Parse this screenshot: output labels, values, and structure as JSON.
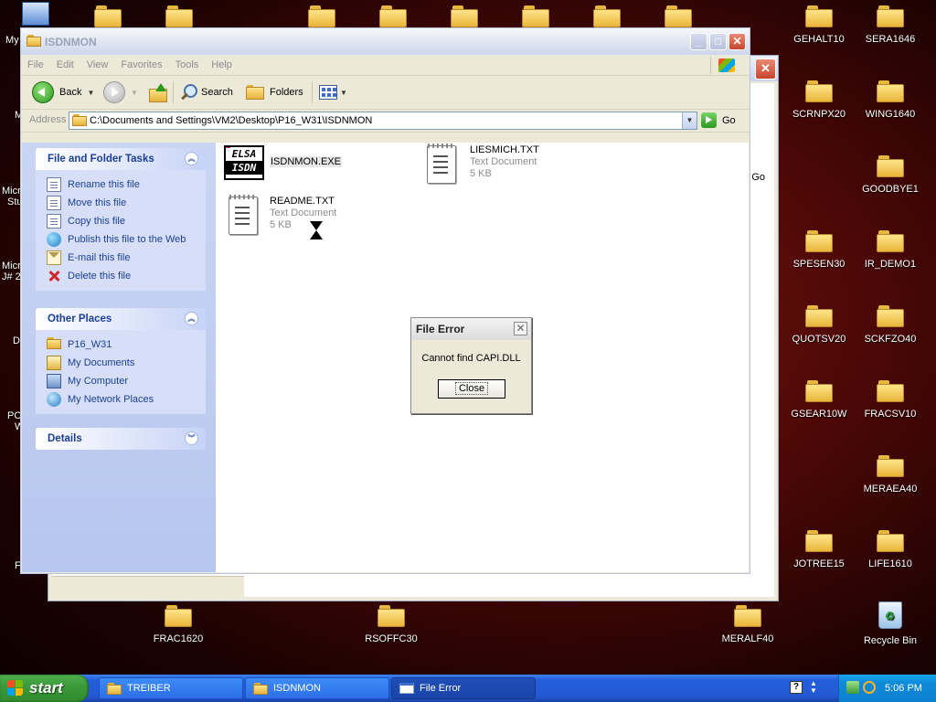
{
  "desktop": {
    "icons_right": [
      {
        "label": "GEHALT10"
      },
      {
        "label": "SERA1646"
      },
      {
        "label": "SCRNPX20"
      },
      {
        "label": "WING1640"
      },
      {
        "label": "GOODBYE1"
      },
      {
        "label": "SPESEN30"
      },
      {
        "label": "IR_DEMO1"
      },
      {
        "label": "QUOTSV20"
      },
      {
        "label": "SCKFZO40"
      },
      {
        "label": "GSEAR10W"
      },
      {
        "label": "FRACSV10"
      },
      {
        "label": "MERAEA40"
      },
      {
        "label": "JOTREE15"
      },
      {
        "label": "LIFE1610"
      },
      {
        "label": "Recycle Bin"
      }
    ],
    "icons_bottom": [
      {
        "label": "FRAC1620"
      },
      {
        "label": "RSOFFC30"
      },
      {
        "label": "MERALF40"
      }
    ],
    "peek_labels": [
      "My",
      "M",
      "Micr",
      "Stu",
      "Micr",
      "J# 2",
      "D",
      "PO",
      "W",
      "F"
    ]
  },
  "window": {
    "title": "ISDNMON",
    "menu": [
      "File",
      "Edit",
      "View",
      "Favorites",
      "Tools",
      "Help"
    ],
    "toolbar": {
      "back": "Back",
      "search": "Search",
      "folders": "Folders"
    },
    "address_label": "Address",
    "address_path": "C:\\Documents and Settings\\VM2\\Desktop\\P16_W31\\ISDNMON",
    "go_label": "Go",
    "back_window_peek": "Go"
  },
  "left_pane": {
    "file_tasks": {
      "title": "File and Folder Tasks",
      "items": [
        {
          "label": "Rename this file",
          "icon": "rename-icon"
        },
        {
          "label": "Move this file",
          "icon": "move-icon"
        },
        {
          "label": "Copy this file",
          "icon": "copy-icon"
        },
        {
          "label": "Publish this file to the Web",
          "icon": "globe-icon"
        },
        {
          "label": "E-mail this file",
          "icon": "email-icon"
        },
        {
          "label": "Delete this file",
          "icon": "delete-icon"
        }
      ]
    },
    "other_places": {
      "title": "Other Places",
      "items": [
        {
          "label": "P16_W31",
          "icon": "folder-icon"
        },
        {
          "label": "My Documents",
          "icon": "my-documents-icon"
        },
        {
          "label": "My Computer",
          "icon": "my-computer-icon"
        },
        {
          "label": "My Network Places",
          "icon": "network-places-icon"
        }
      ]
    },
    "details": {
      "title": "Details"
    }
  },
  "files": [
    {
      "name": "ISDNMON.EXE",
      "icon": "elsa-isdn-icon",
      "icon_text": [
        "ELSA",
        "ISDN"
      ]
    },
    {
      "name": "LIESMICH.TXT",
      "type": "Text Document",
      "size": "5 KB",
      "icon": "text-document-icon"
    },
    {
      "name": "README.TXT",
      "type": "Text Document",
      "size": "5 KB",
      "icon": "text-document-icon"
    }
  ],
  "dialog": {
    "title": "File Error",
    "message": "Cannot find CAPI.DLL",
    "button": "Close"
  },
  "taskbar": {
    "start": "start",
    "buttons": [
      {
        "label": "TREIBER",
        "icon": "folder-icon",
        "active": false
      },
      {
        "label": "ISDNMON",
        "icon": "folder-icon",
        "active": false
      },
      {
        "label": "File Error",
        "icon": "window-icon",
        "active": true
      }
    ],
    "clock": "5:06 PM"
  },
  "colors": {
    "xp_blue": "#245edb",
    "start_green": "#3c9a3a",
    "link_blue": "#1c3f94",
    "desktop_red": "#7a1410"
  }
}
